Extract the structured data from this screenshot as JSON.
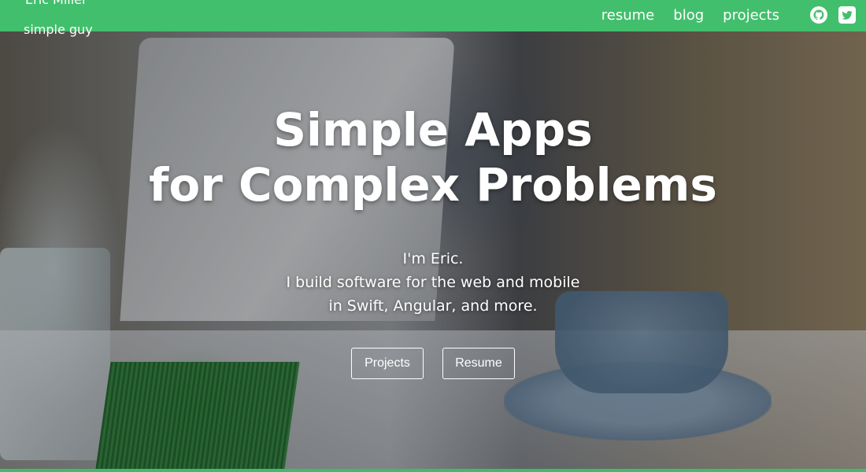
{
  "nav": {
    "brand_name": "Eric Miller",
    "brand_tagline": "simple guy",
    "links": [
      {
        "label": "resume"
      },
      {
        "label": "blog"
      },
      {
        "label": "projects"
      }
    ],
    "social": [
      {
        "icon": "github-icon"
      },
      {
        "icon": "twitter-icon"
      }
    ]
  },
  "hero": {
    "title_lines": [
      "Simple Apps",
      "for Complex Problems"
    ],
    "subtitle_lines": [
      "I'm Eric.",
      "I build software for the web and mobile",
      "in Swift, Angular, and more."
    ],
    "buttons": {
      "projects": "Projects",
      "resume": "Resume"
    }
  },
  "colors": {
    "accent": "#42bf6c",
    "text": "#ffffff"
  }
}
